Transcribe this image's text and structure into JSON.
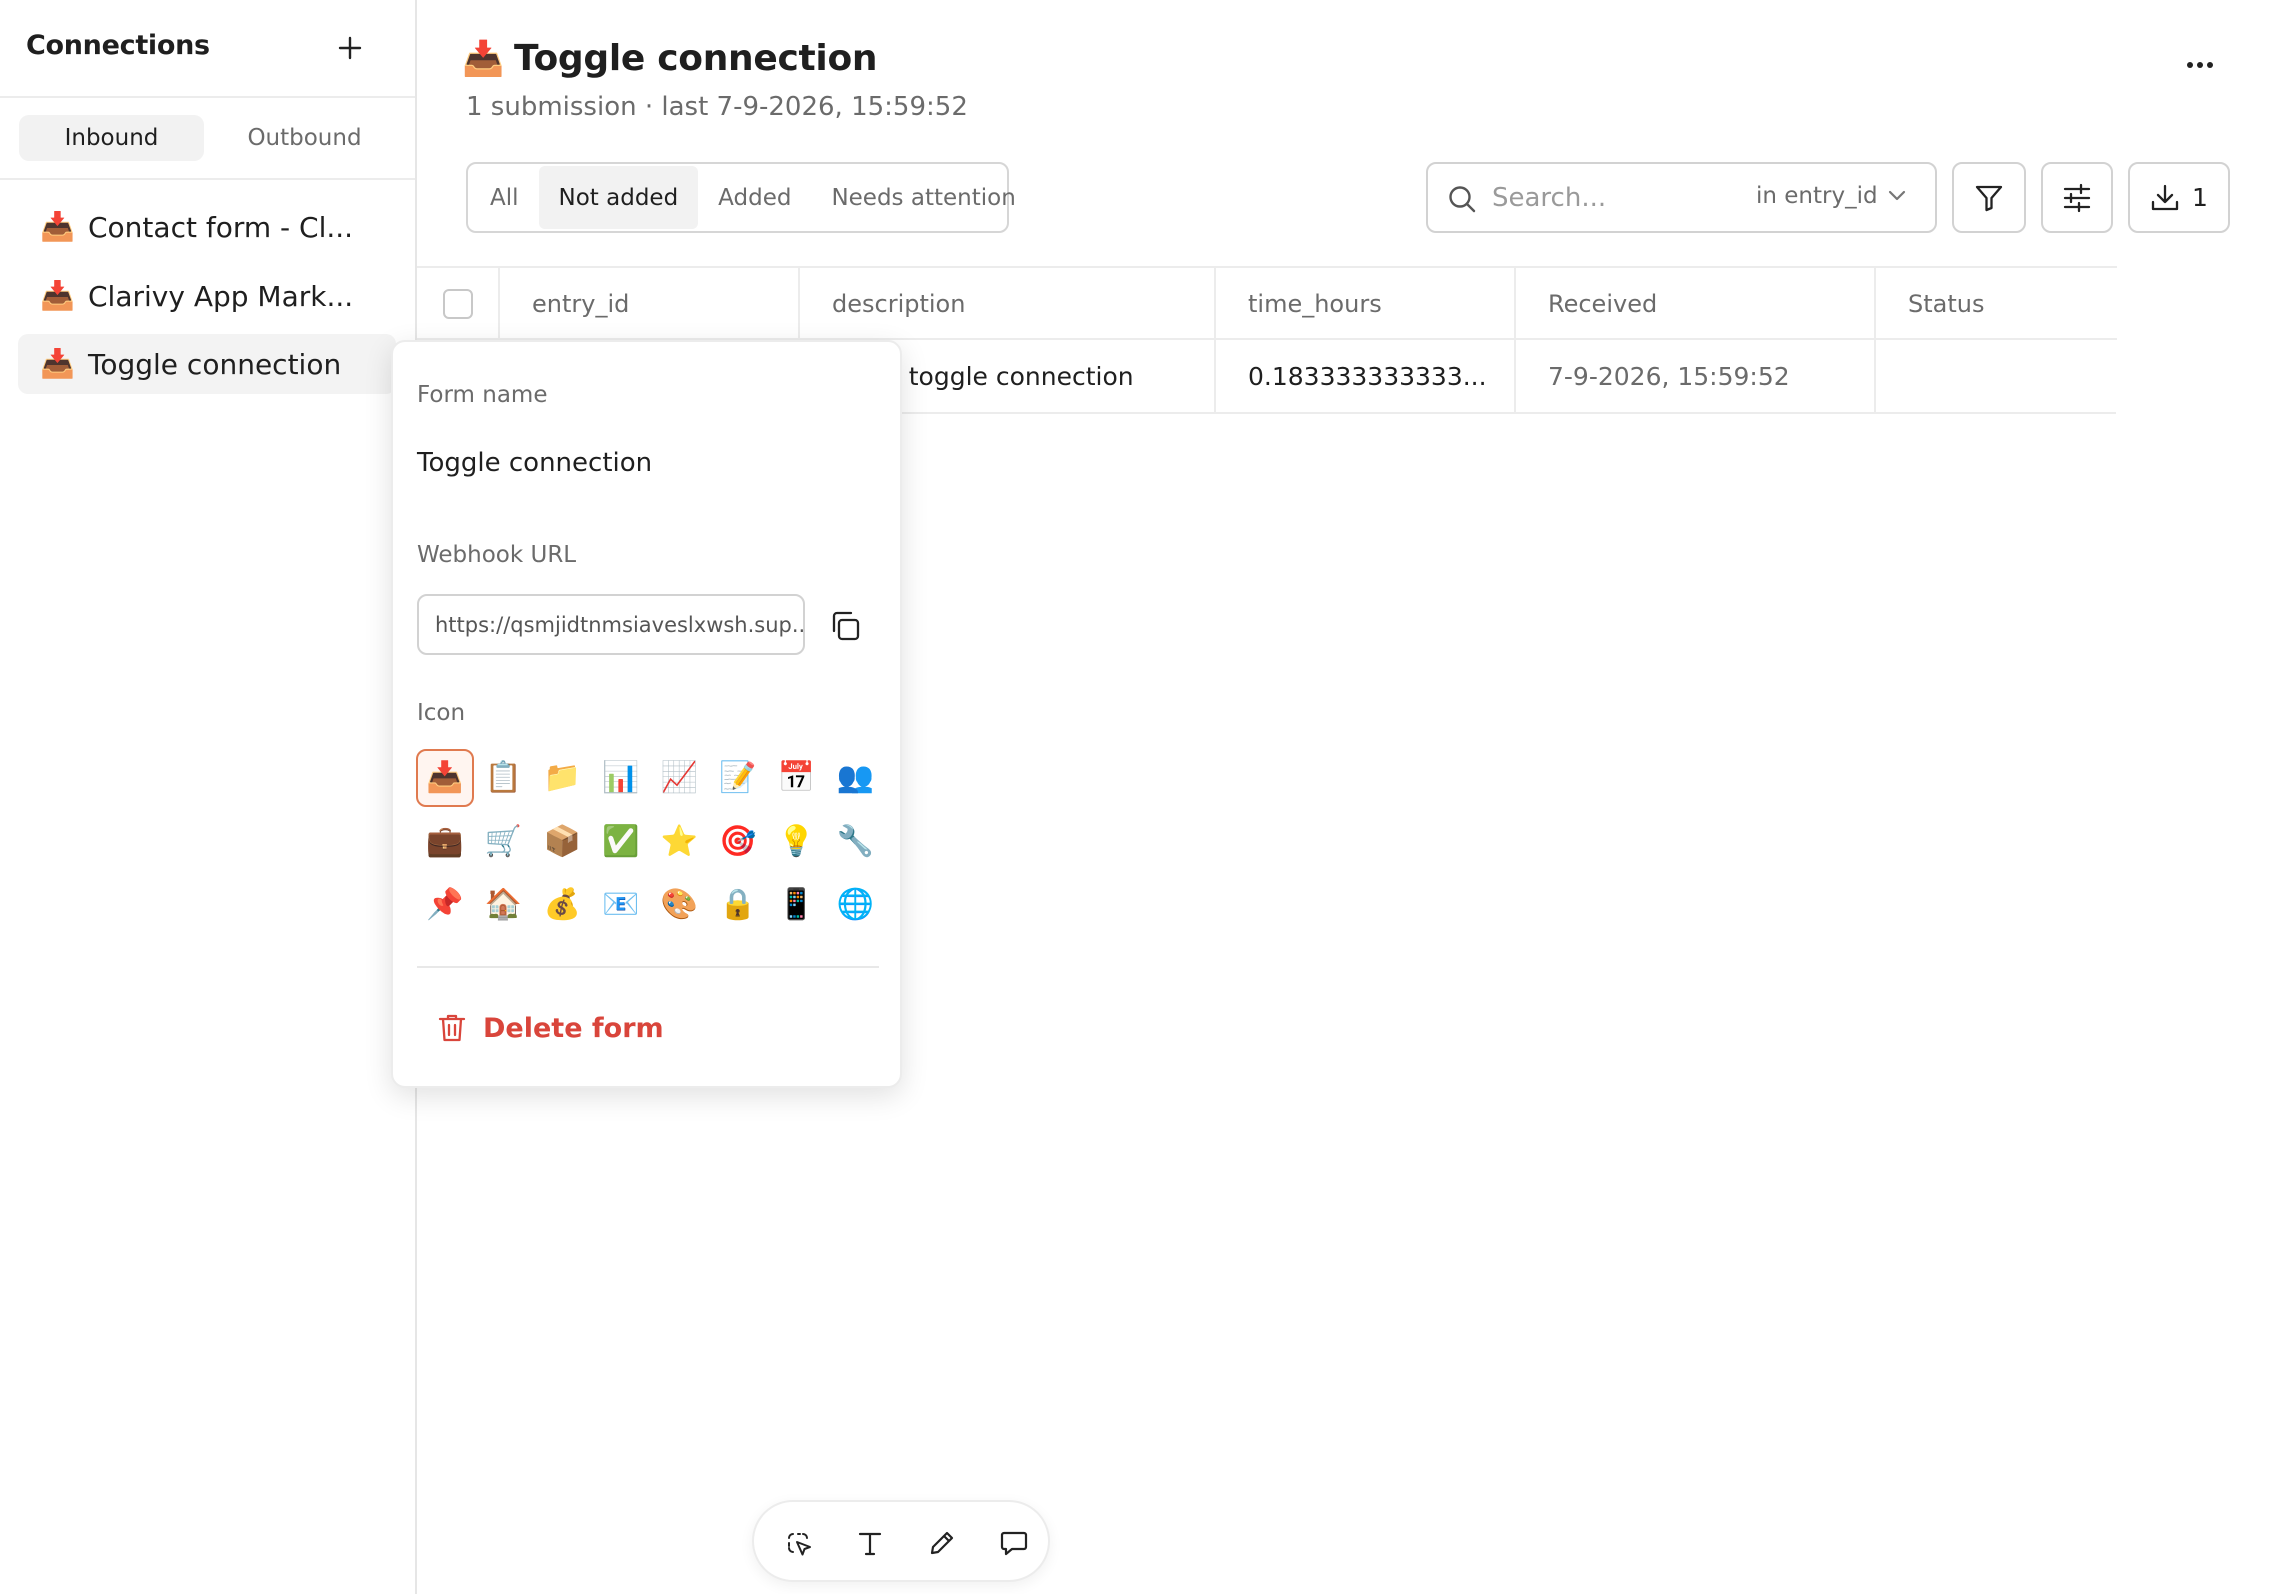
{
  "sidebar": {
    "title": "Connections",
    "add_icon": "plus-icon",
    "tabs": [
      {
        "label": "Inbound",
        "active": true
      },
      {
        "label": "Outbound",
        "active": false
      }
    ],
    "items": [
      {
        "icon": "📥",
        "label": "Contact form - Cl...",
        "active": false
      },
      {
        "icon": "📥",
        "label": "Clarivy App Mark...",
        "active": false
      },
      {
        "icon": "📥",
        "label": "Toggle connection",
        "active": true
      }
    ]
  },
  "main": {
    "icon": "📥",
    "title": "Toggle connection",
    "subtitle": "1 submission · last 7-9-2026, 15:59:52",
    "more_icon": "more-horizontal-icon",
    "filters": [
      "All",
      "Not added",
      "Added",
      "Needs attention"
    ],
    "active_filter": "Not added",
    "search": {
      "placeholder": "Search...",
      "scope": "in entry_id"
    },
    "export_count": "1"
  },
  "table": {
    "columns": [
      "entry_id",
      "description",
      "time_hours",
      "Received",
      "Status"
    ],
    "rows": [
      {
        "entry_id": "",
        "description": "y toggle connection",
        "time_hours": "0.183333333333...",
        "received": "7-9-2026, 15:59:52",
        "status": ""
      }
    ]
  },
  "popover": {
    "form_name_label": "Form name",
    "form_name": "Toggle connection",
    "webhook_label": "Webhook URL",
    "webhook_url": "https://qsmjidtnmsiaveslxwsh.sup...",
    "icon_label": "Icon",
    "icons": [
      "📥",
      "📋",
      "📁",
      "📊",
      "📈",
      "📝",
      "📅",
      "👥",
      "💼",
      "🛒",
      "📦",
      "✅",
      "⭐",
      "🎯",
      "💡",
      "🔧",
      "📌",
      "🏠",
      "💰",
      "📧",
      "🎨",
      "🔒",
      "📱",
      "🌐"
    ],
    "selected_icon": 0,
    "delete_label": "Delete form"
  },
  "colors": {
    "danger": "#d9453b",
    "selected_icon_border": "#e07a4f",
    "border": "#ececec",
    "muted_text": "#6b6b6b"
  }
}
